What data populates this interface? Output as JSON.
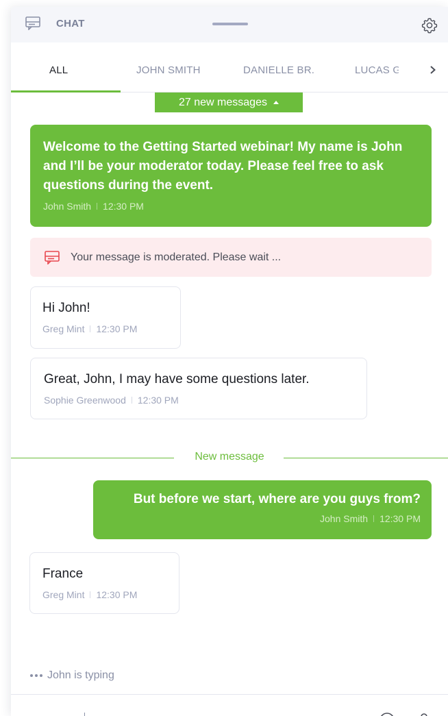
{
  "header": {
    "title": "CHAT",
    "chat_icon": "chat-icon",
    "settings_icon": "gear-icon"
  },
  "tabs": [
    {
      "label": "ALL",
      "active": true
    },
    {
      "label": "JOHN SMITH",
      "active": false
    },
    {
      "label": "DANIELLE BR.",
      "active": false
    },
    {
      "label": "LUCAS GR",
      "active": false
    }
  ],
  "new_messages": {
    "label": "27 new messages"
  },
  "messages": [
    {
      "text": "Welcome to the Getting Started webinar! My name is John and I’ll be your moderator today. Please feel free to ask questions during the event.",
      "author": "John Smith",
      "time": "12:30 PM",
      "outgoing": true
    },
    {
      "text": "Hi John!",
      "author": "Greg Mint",
      "time": "12:30 PM",
      "outgoing": false
    },
    {
      "text": "Great, John, I may have some questions later.",
      "author": "Sophie Greenwood",
      "time": "12:30 PM",
      "outgoing": false
    },
    {
      "text": "But before we start, where are you guys from?",
      "author": "John Smith",
      "time": "12:30 PM",
      "outgoing": true
    },
    {
      "text": "France",
      "author": "Greg Mint",
      "time": "12:30 PM",
      "outgoing": false
    }
  ],
  "moderation_notice": "Your message is moderated. Please wait ...",
  "divider_label": "New message",
  "typing_indicator": "John is typing",
  "colors": {
    "accent_green": "#6cbd3c",
    "moderation_bg": "#fdecee",
    "moderation_icon": "#e8474f"
  }
}
